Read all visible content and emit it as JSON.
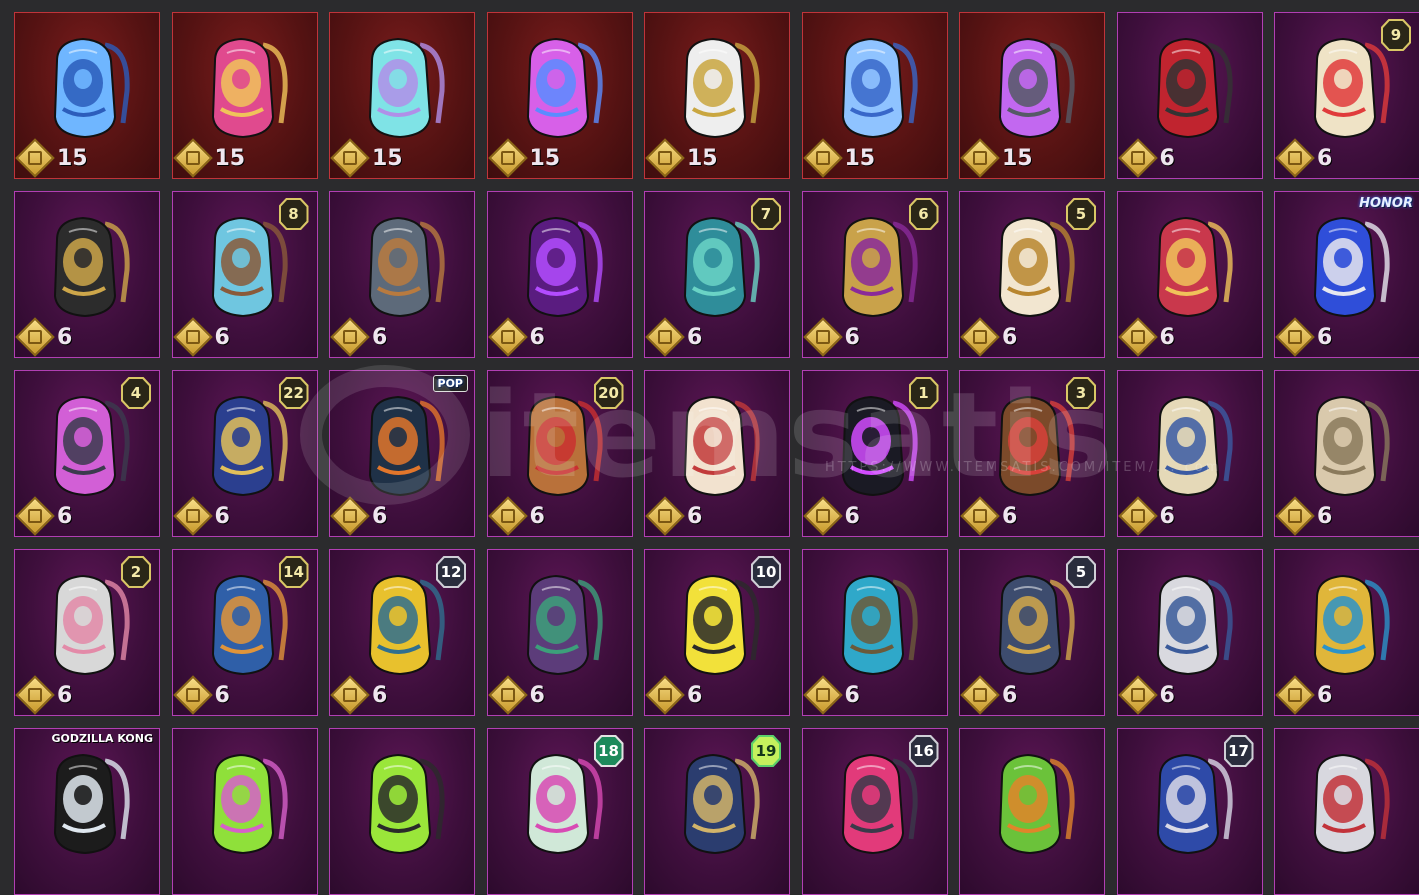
{
  "items": [
    {
      "price": "15",
      "rarity": "red",
      "icon": "frost-orb-backpack-icon",
      "colors": [
        "#6fb6ff",
        "#2c5dbb"
      ]
    },
    {
      "price": "15",
      "rarity": "red",
      "icon": "crimson-hourglass-backpack-icon",
      "colors": [
        "#e04a8e",
        "#f0c35a"
      ]
    },
    {
      "price": "15",
      "rarity": "red",
      "icon": "teal-lace-backpack-icon",
      "colors": [
        "#7fe3e6",
        "#b08fe8"
      ]
    },
    {
      "price": "15",
      "rarity": "red",
      "icon": "neon-demon-backpack-icon",
      "colors": [
        "#d760e8",
        "#5a8cff"
      ]
    },
    {
      "price": "15",
      "rarity": "red",
      "icon": "winged-shield-backpack-icon",
      "colors": [
        "#eeeeee",
        "#c9a640"
      ]
    },
    {
      "price": "15",
      "rarity": "red",
      "icon": "crystal-globe-backpack-icon",
      "colors": [
        "#8fc3ff",
        "#3867c9"
      ]
    },
    {
      "price": "15",
      "rarity": "red",
      "icon": "drill-mech-backpack-icon",
      "colors": [
        "#c268f0",
        "#555a66"
      ]
    },
    {
      "price": "6",
      "rarity": "purple",
      "icon": "red-circuit-backpack-icon",
      "colors": [
        "#c0242f",
        "#333"
      ]
    },
    {
      "price": "6",
      "rarity": "purple",
      "icon": "robot-face-backpack-icon",
      "colors": [
        "#efe3c6",
        "#e03b3b"
      ],
      "badge": "9",
      "badge_style": "gold"
    },
    {
      "price": "6",
      "rarity": "purple",
      "icon": "toad-backpack-icon",
      "colors": [
        "#2c2c2c",
        "#cda64a"
      ]
    },
    {
      "price": "6",
      "rarity": "purple",
      "icon": "octopus-backpack-icon",
      "colors": [
        "#6fc6e0",
        "#8a5a3a"
      ],
      "badge": "8",
      "badge_style": "gold"
    },
    {
      "price": "6",
      "rarity": "purple",
      "icon": "shovel-backpack-icon",
      "colors": [
        "#5d6a7a",
        "#b87a3f"
      ]
    },
    {
      "price": "6",
      "rarity": "purple",
      "icon": "void-skull-backpack-icon",
      "colors": [
        "#5a1c80",
        "#b34cff"
      ]
    },
    {
      "price": "6",
      "rarity": "purple",
      "icon": "astronaut-backpack-icon",
      "colors": [
        "#2f8d9a",
        "#6ad3c5"
      ],
      "badge": "7",
      "badge_style": "gold"
    },
    {
      "price": "6",
      "rarity": "purple",
      "icon": "gem-frame-backpack-icon",
      "colors": [
        "#c9a24a",
        "#8a2a9a"
      ],
      "badge": "6",
      "badge_style": "gold"
    },
    {
      "price": "6",
      "rarity": "purple",
      "icon": "ornate-gold-backpack-icon",
      "colors": [
        "#f2e6d0",
        "#b8862f"
      ],
      "badge": "5",
      "badge_style": "gold"
    },
    {
      "price": "6",
      "rarity": "purple",
      "icon": "heart-arrow-backpack-icon",
      "colors": [
        "#c9384c",
        "#f0c35a"
      ]
    },
    {
      "price": "6",
      "rarity": "purple",
      "icon": "honor-globe-backpack-icon",
      "colors": [
        "#2f4ed9",
        "#e7e7ef"
      ],
      "tag": "HONOR"
    },
    {
      "price": "6",
      "rarity": "purple",
      "icon": "cat-ear-backpack-icon",
      "colors": [
        "#d25fd6",
        "#3b3b4d"
      ],
      "badge": "4",
      "badge_style": "gold"
    },
    {
      "price": "6",
      "rarity": "purple",
      "icon": "royal-blue-backpack-icon",
      "colors": [
        "#2b3f8f",
        "#e2c05a"
      ],
      "badge": "22",
      "badge_style": "gold"
    },
    {
      "price": "6",
      "rarity": "purple",
      "icon": "penguin-backpack-icon",
      "colors": [
        "#1f3147",
        "#e2762b"
      ],
      "tag": "POP"
    },
    {
      "price": "6",
      "rarity": "purple",
      "icon": "boxing-bear-backpack-icon",
      "colors": [
        "#b9713a",
        "#c93030"
      ],
      "badge": "20",
      "badge_style": "gold"
    },
    {
      "price": "6",
      "rarity": "purple",
      "icon": "lucky-cat-backpack-icon",
      "colors": [
        "#f2e2cf",
        "#c23a3a"
      ]
    },
    {
      "price": "6",
      "rarity": "purple",
      "icon": "pixel-ghost-backpack-icon",
      "colors": [
        "#1a1a24",
        "#d24cff"
      ],
      "badge": "1",
      "badge_style": "gold"
    },
    {
      "price": "6",
      "rarity": "purple",
      "icon": "crowned-bear-backpack-icon",
      "colors": [
        "#7b4a2a",
        "#d8413a"
      ],
      "badge": "3",
      "badge_style": "gold"
    },
    {
      "price": "6",
      "rarity": "purple",
      "icon": "golden-vase-backpack-icon",
      "colors": [
        "#e5d9b8",
        "#3b5ba3"
      ]
    },
    {
      "price": "6",
      "rarity": "purple",
      "icon": "plush-star-backpack-icon",
      "colors": [
        "#d9c9ac",
        "#8a7a5c"
      ]
    },
    {
      "price": "6",
      "rarity": "purple",
      "icon": "spiked-shield-backpack-icon",
      "colors": [
        "#d8d8d8",
        "#e38aa8"
      ],
      "badge": "2",
      "badge_style": "gold"
    },
    {
      "price": "6",
      "rarity": "purple",
      "icon": "treasure-chest-backpack-icon",
      "colors": [
        "#2f5fa8",
        "#e0943a"
      ],
      "badge": "14",
      "badge_style": "gold"
    },
    {
      "price": "6",
      "rarity": "purple",
      "icon": "yellow-console-backpack-icon",
      "colors": [
        "#e8c12d",
        "#2f6f8f"
      ],
      "badge": "12",
      "badge_style": "dark"
    },
    {
      "price": "6",
      "rarity": "purple",
      "icon": "arcade-monster-backpack-icon",
      "colors": [
        "#5c3c7a",
        "#3ca07a"
      ]
    },
    {
      "price": "6",
      "rarity": "purple",
      "icon": "weather-screen-backpack-icon",
      "colors": [
        "#f2e13a",
        "#2a2a2a"
      ],
      "badge": "10",
      "badge_style": "dark"
    },
    {
      "price": "6",
      "rarity": "purple",
      "icon": "winged-armor-backpack-icon",
      "colors": [
        "#2fa8c9",
        "#6b5a3a"
      ]
    },
    {
      "price": "6",
      "rarity": "purple",
      "icon": "clockwork-backpack-icon",
      "colors": [
        "#3d4c6e",
        "#d2a84a"
      ],
      "badge": "5",
      "badge_style": "dark"
    },
    {
      "price": "6",
      "rarity": "purple",
      "icon": "steel-skull-backpack-icon",
      "colors": [
        "#d9d9df",
        "#3a5a9a"
      ]
    },
    {
      "price": "6",
      "rarity": "purple",
      "icon": "golden-tiara-backpack-icon",
      "colors": [
        "#e0b63a",
        "#2b93c9"
      ]
    },
    {
      "price": "",
      "rarity": "purple",
      "icon": "godzilla-backpack-icon",
      "colors": [
        "#1c1c1c",
        "#dfe7ef"
      ],
      "tag": "GODZILLA KONG"
    },
    {
      "price": "",
      "rarity": "purple",
      "icon": "goggle-cup-backpack-icon",
      "colors": [
        "#8fe03a",
        "#d660c9"
      ]
    },
    {
      "price": "",
      "rarity": "purple",
      "icon": "arrow-quiver-backpack-icon",
      "colors": [
        "#9ae63a",
        "#2a2a2a"
      ]
    },
    {
      "price": "",
      "rarity": "purple",
      "icon": "graffiti-backpack-icon",
      "colors": [
        "#d0e8d8",
        "#d84ab4"
      ],
      "badge": "18",
      "badge_style": "red"
    },
    {
      "price": "",
      "rarity": "purple",
      "icon": "deer-owl-backpack-icon",
      "colors": [
        "#2b3d6f",
        "#d2b46a"
      ],
      "badge": "19",
      "badge_style": "green"
    },
    {
      "price": "",
      "rarity": "purple",
      "icon": "pink-robot-backpack-icon",
      "colors": [
        "#e23a7a",
        "#3a3a4a"
      ],
      "badge": "16",
      "badge_style": "dark"
    },
    {
      "price": "",
      "rarity": "purple",
      "icon": "cactus-backpack-icon",
      "colors": [
        "#6bc23a",
        "#e0852a"
      ]
    },
    {
      "price": "",
      "rarity": "purple",
      "icon": "stars-stripes-backpack-icon",
      "colors": [
        "#2e4aa8",
        "#d8d8e6"
      ],
      "badge": "17",
      "badge_style": "dark"
    },
    {
      "price": "",
      "rarity": "purple",
      "icon": "cat-skull-backpack-icon",
      "colors": [
        "#d8d8df",
        "#c2323a"
      ]
    }
  ],
  "watermark": {
    "text": "itemsatis",
    "url": "HTTPS://WWW.ITEMSATIS.COM/ITEM/...",
    "suffix": "com"
  }
}
